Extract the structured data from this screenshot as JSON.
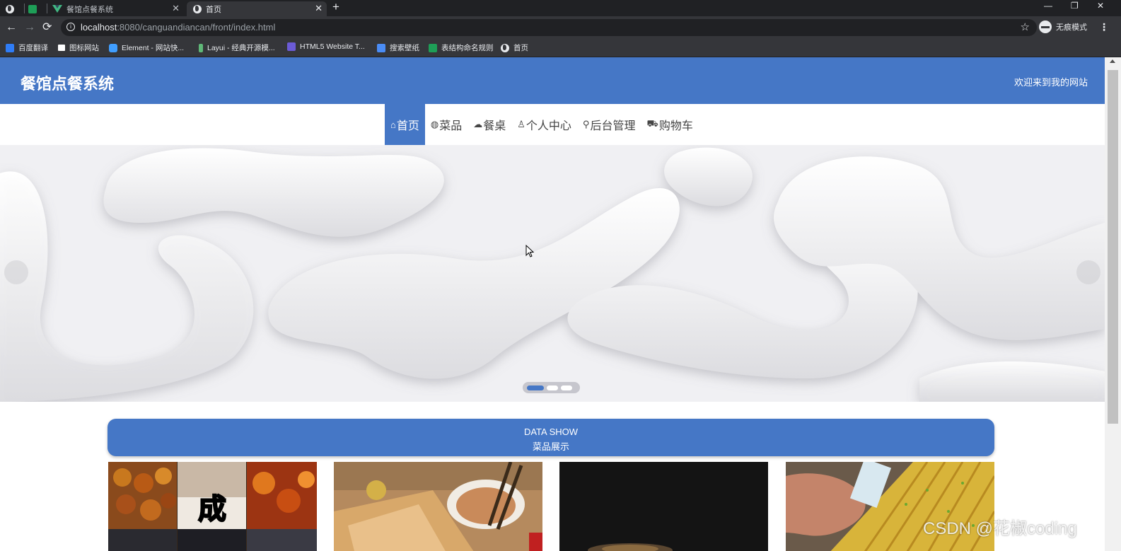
{
  "browser": {
    "tabs": [
      {
        "title": "",
        "icon": "globe-icon"
      },
      {
        "title": "",
        "icon": "green-square-icon"
      },
      {
        "title": "餐馆点餐系统",
        "icon": "vue-icon"
      },
      {
        "title": "首页",
        "icon": "globe-icon"
      }
    ],
    "new_tab": "+",
    "close_glyph": "✕",
    "window_controls": [
      "—",
      "❐",
      "✕"
    ],
    "url_host": "localhost",
    "url_path": ":8080/canguandiancan/front/index.html",
    "incognito_label": "无痕模式",
    "bookmarks": [
      {
        "label": "百度翻译",
        "color": "#2f7cf6"
      },
      {
        "label": "图标网站",
        "color": "#ffffff"
      },
      {
        "label": "Element - 网站快...",
        "color": "#409eff"
      },
      {
        "label": "Layui - 经典开源模...",
        "color": "#5fb878"
      },
      {
        "label": "HTML5 Website T...",
        "color": "#6b5bd6"
      },
      {
        "label": "搜索壁纸",
        "color": "#4a8cf5"
      },
      {
        "label": "表结构命名规则",
        "color": "#1e9e57"
      },
      {
        "label": "首页",
        "color": "#e8eaed"
      }
    ]
  },
  "site": {
    "title": "餐馆点餐系统",
    "welcome": "欢迎来到我的网站",
    "accent": "#4577c6",
    "menu": [
      {
        "label": "首页",
        "icon": "⌂",
        "icon_name": "home-icon",
        "active": true
      },
      {
        "label": "菜品",
        "icon": "◍",
        "icon_name": "globe-icon",
        "active": false
      },
      {
        "label": "餐桌",
        "icon": "☁",
        "icon_name": "table-icon",
        "active": false
      },
      {
        "label": "个人中心",
        "icon": "♙",
        "icon_name": "user-icon",
        "active": false
      },
      {
        "label": "后台管理",
        "icon": "⚲",
        "icon_name": "link-icon",
        "active": false
      },
      {
        "label": "购物车",
        "icon": "⛟",
        "icon_name": "cart-icon",
        "active": false
      }
    ],
    "carousel": {
      "slide_count": 3,
      "active_index": 0
    },
    "section": {
      "en": "DATA SHOW",
      "zh": "菜品展示"
    },
    "cards": [
      {
        "name": "dish-card-1",
        "overlay_text": "成"
      },
      {
        "name": "dish-card-2",
        "overlay_text": ""
      },
      {
        "name": "dish-card-3",
        "overlay_text": ""
      },
      {
        "name": "dish-card-4",
        "overlay_text": ""
      }
    ]
  },
  "watermark": "CSDN @花椒coding"
}
